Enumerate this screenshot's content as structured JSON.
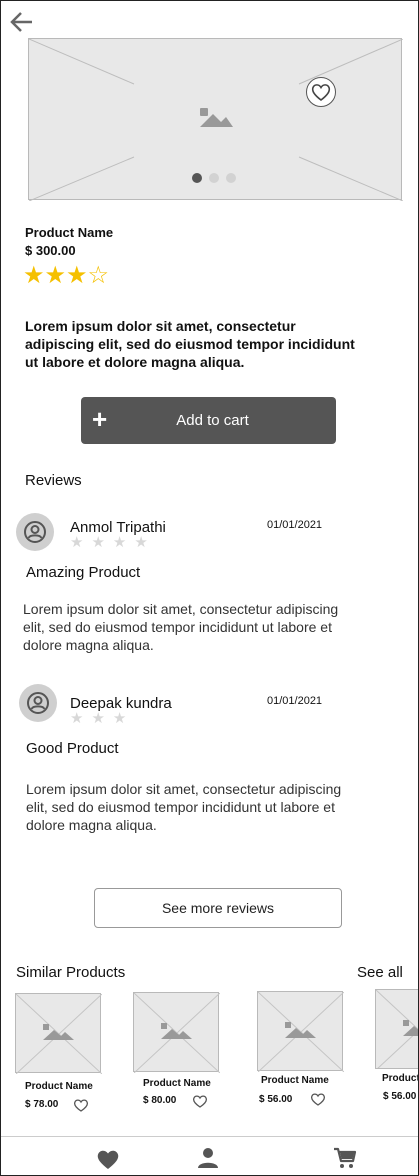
{
  "header": {
    "back_icon": "arrow-left-icon"
  },
  "product": {
    "name": "Product Name",
    "price": "$ 300.00",
    "rating": 3,
    "rating_max": 4,
    "stars_full": "★★★",
    "stars_empty": "☆",
    "description": "Lorem ipsum dolor sit amet, consectetur adipiscing elit, sed do eiusmod tempor incididunt ut labore et dolore magna aliqua.",
    "carousel_active": 1,
    "carousel_count": 3
  },
  "cart": {
    "label": "Add to cart",
    "plus": "+"
  },
  "reviews": {
    "heading": "Reviews",
    "items": [
      {
        "name": "Anmol Tripathi",
        "date": "01/01/2021",
        "stars": "★★★★",
        "title": "Amazing Product",
        "text": "Lorem ipsum dolor sit amet, consectetur adipiscing elit, sed do eiusmod tempor incididunt ut labore et dolore magna aliqua."
      },
      {
        "name": "Deepak kundra",
        "date": "01/01/2021",
        "stars": "★★★",
        "title": "Good  Product",
        "text": "Lorem ipsum dolor sit amet, consectetur adipiscing elit, sed do eiusmod tempor incididunt ut labore et dolore magna aliqua."
      }
    ],
    "see_more": "See more reviews"
  },
  "similar": {
    "heading": "Similar Products",
    "see_all": "See all",
    "items": [
      {
        "name": "Product Name",
        "price": "$ 78.00"
      },
      {
        "name": "Product Name",
        "price": "$ 80.00"
      },
      {
        "name": "Product Name",
        "price": "$ 56.00"
      },
      {
        "name": "Product Name",
        "price": "$ 56.00"
      }
    ]
  },
  "bottom_nav": {
    "items": [
      "heart-icon",
      "user-icon",
      "cart-icon"
    ]
  },
  "colors": {
    "accent": "#555555",
    "star": "#f5c000",
    "placeholder": "#e8e8e8"
  }
}
